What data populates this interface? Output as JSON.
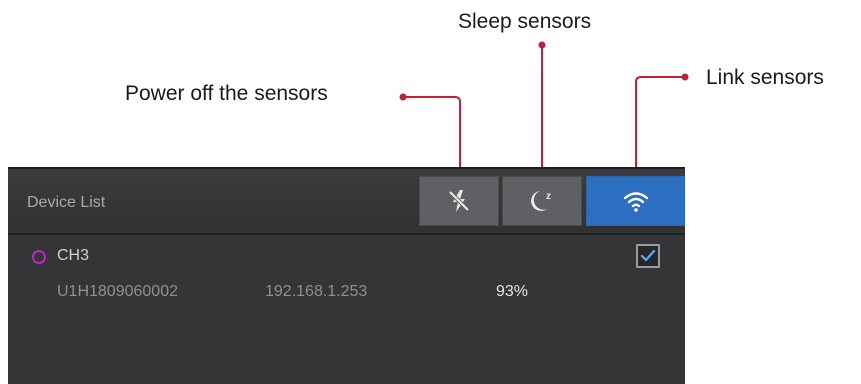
{
  "callouts": {
    "power_off": "Power off the sensors",
    "sleep": "Sleep sensors",
    "link": "Link sensors"
  },
  "panel": {
    "title": "Device List",
    "toolbar": [
      {
        "name": "power-off-button",
        "icon": "flash-off-icon"
      },
      {
        "name": "sleep-button",
        "icon": "moon-z-icon"
      },
      {
        "name": "link-button",
        "icon": "wifi-icon",
        "active": true
      }
    ]
  },
  "devices": [
    {
      "channel": "CH3",
      "serial": "U1H1809060002",
      "ip": "192.168.1.253",
      "battery": "93%",
      "checked": true,
      "status_color": "#c81fc8"
    }
  ],
  "colors": {
    "callout_line": "#c41e3a",
    "active_button": "#2c6fc0",
    "panel_bg": "#333536"
  }
}
